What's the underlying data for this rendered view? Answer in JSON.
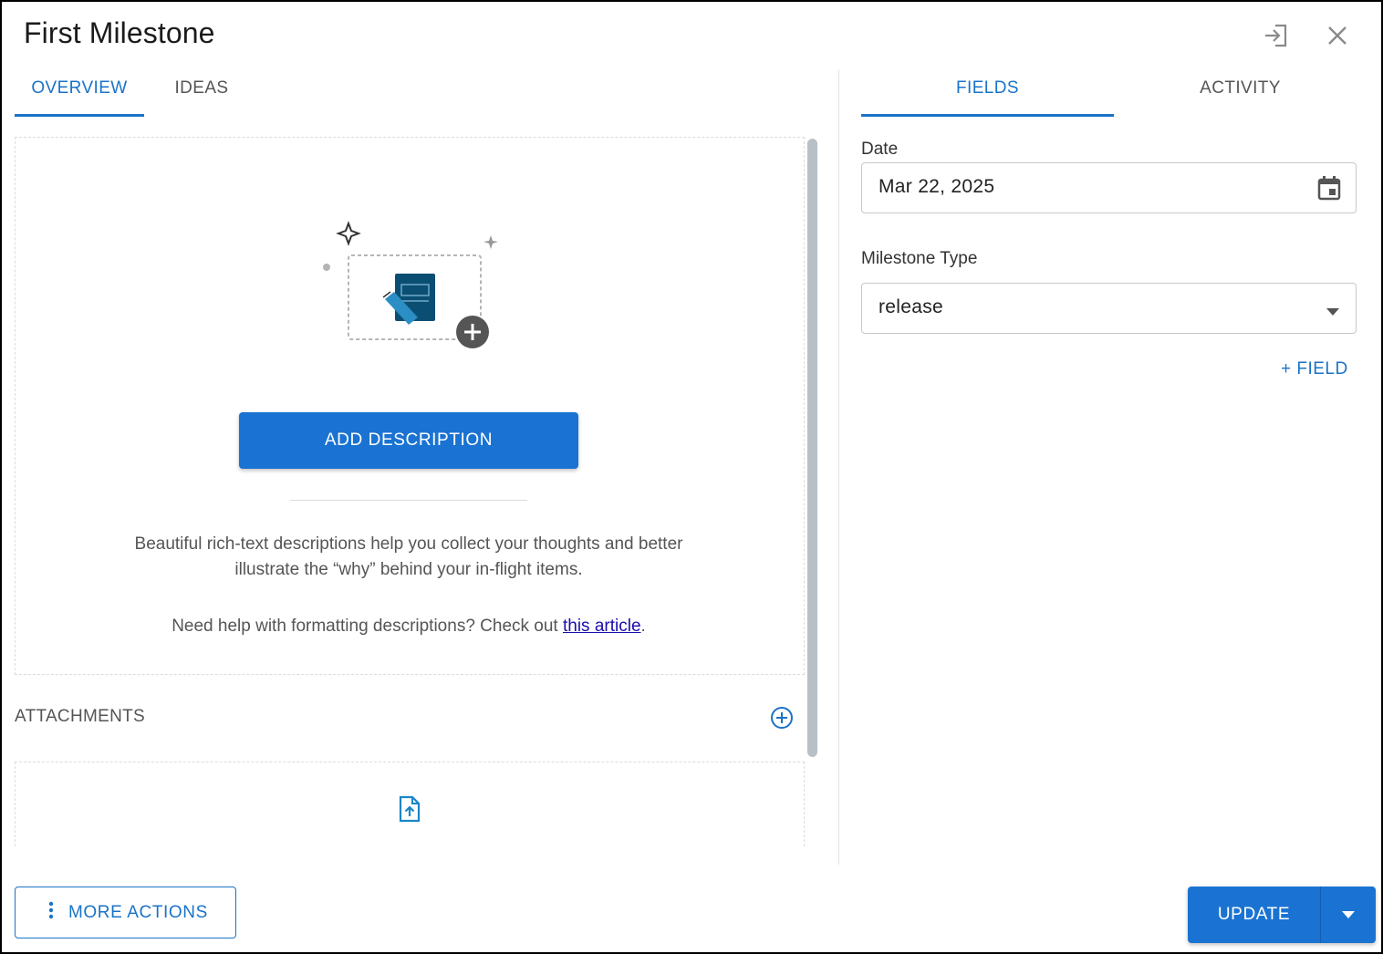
{
  "header": {
    "title": "First Milestone",
    "icons": [
      "export-icon",
      "close-icon"
    ]
  },
  "left_tabs": [
    {
      "label": "OVERVIEW",
      "active": true
    },
    {
      "label": "IDEAS",
      "active": false
    }
  ],
  "right_tabs": [
    {
      "label": "FIELDS",
      "active": true
    },
    {
      "label": "ACTIVITY",
      "active": false
    }
  ],
  "description": {
    "button_label": "ADD DESCRIPTION",
    "text_line1": "Beautiful rich-text descriptions help you collect your thoughts and better",
    "text_line2": "illustrate the “why” behind your in-flight items.",
    "help_prefix": "Need help with formatting descriptions? Check out ",
    "help_link": "this article",
    "help_suffix": "."
  },
  "attachments": {
    "label": "ATTACHMENTS"
  },
  "fields": {
    "date_label": "Date",
    "date_value": "Mar 22, 2025",
    "type_label": "Milestone Type",
    "type_value": "release",
    "add_field_label": "+ FIELD"
  },
  "footer": {
    "more_actions_label": "MORE ACTIONS",
    "update_label": "UPDATE"
  },
  "colors": {
    "accent": "#1a73c8",
    "button": "#1a73d2",
    "link": "#1a0dab"
  }
}
